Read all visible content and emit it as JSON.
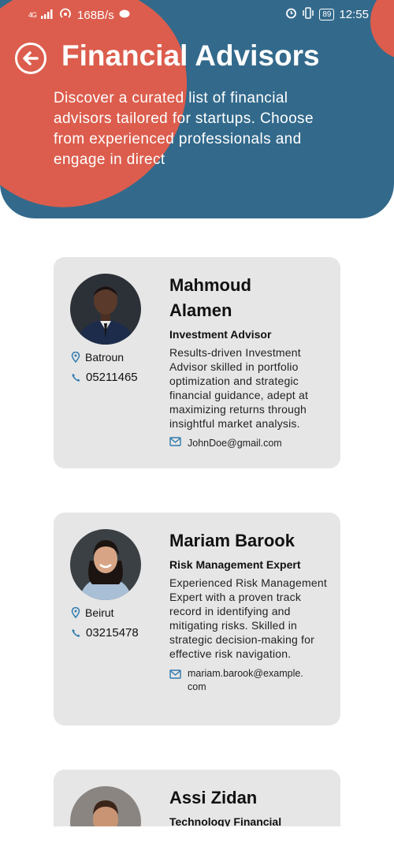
{
  "status_bar": {
    "network": "4G",
    "speed": "168B/s",
    "battery": "89",
    "time": "12:55"
  },
  "header": {
    "title": "Financial Advisors",
    "description": "Discover a curated list of financial advisors tailored for startups. Choose from experienced professionals and engage in direct"
  },
  "advisors": [
    {
      "name": "Mahmoud Alamen",
      "role": "Investment Advisor",
      "bio": "Results-driven Investment Advisor skilled in portfolio optimization and strategic financial guidance, adept at maximizing returns through insightful market analysis.",
      "email": "JohnDoe@gmail.com",
      "location": "Batroun",
      "phone": "05211465"
    },
    {
      "name": "Mariam Barook",
      "role": "Risk Management Expert",
      "bio": "Experienced Risk Management Expert with a proven track record in identifying and mitigating risks. Skilled in strategic decision-making for effective risk navigation.",
      "email": "mariam.barook@example.com",
      "location": "Beirut",
      "phone": "03215478"
    },
    {
      "name": "Assi Zidan",
      "role": "Technology Financial"
    }
  ],
  "colors": {
    "header": "#336a8c",
    "accent_blob": "#dc5d4d",
    "card": "#e6e6e6",
    "icon": "#2e79ad"
  }
}
